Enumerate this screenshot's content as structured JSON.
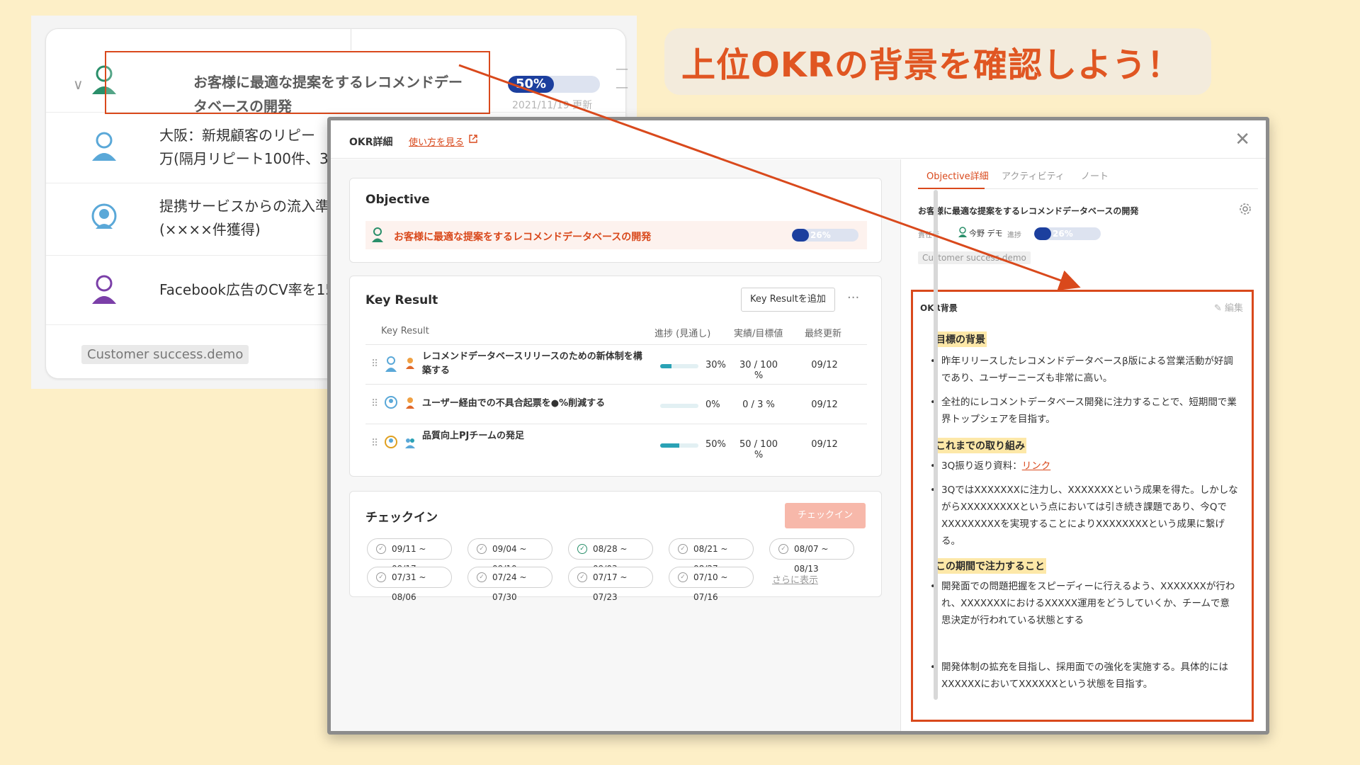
{
  "callout": {
    "text": "上位OKRの背景を確認しよう！"
  },
  "background_list": {
    "rows": [
      {
        "text": "お客様に最適な提案をするレコメンドデー\nタベースの開発",
        "progress_label": "50%",
        "progress": 0.5,
        "updated": "2021/11/19 更新"
      },
      {
        "text": "大阪：新規顧客のリピー\n万(隔月リピート100件、3"
      },
      {
        "text": "提携サービスからの流入準\n(××××件獲得)"
      },
      {
        "text": "Facebook広告のCV率を15"
      }
    ],
    "tag": "Customer success.demo"
  },
  "modal": {
    "title": "OKR詳細",
    "howto_link": "使い方を見る",
    "objective_section": {
      "title": "Objective",
      "objective_text": "お客様に最適な提案をするレコメンドデータベースの開発",
      "progress_label": "26%",
      "progress": 0.26
    },
    "key_result_section": {
      "title": "Key Result",
      "add_button": "Key Resultを追加",
      "more": "···",
      "columns": [
        "Key Result",
        "進捗 (見通し)",
        "実績/目標値",
        "最終更新"
      ],
      "rows": [
        {
          "name": "レコメンドデータベースリリースのための新体制を構築する",
          "progress": 0.3,
          "pct": "30%",
          "actual": "30 / 100 %",
          "updated": "09/12"
        },
        {
          "name": "ユーザー経由での不具合起票を●%削減する",
          "progress": 0.0,
          "pct": "0%",
          "actual": "0 / 3 %",
          "updated": "09/12"
        },
        {
          "name": "品質向上PJチームの発足",
          "progress": 0.5,
          "pct": "50%",
          "actual": "50 / 100 %",
          "updated": "09/12"
        }
      ]
    },
    "checkin_section": {
      "title": "チェックイン",
      "button": "チェックイン",
      "periods": [
        "09/11 ~ 09/17",
        "09/04 ~ 09/10",
        "08/28 ~ 09/03",
        "08/21 ~ 08/27",
        "08/07 ~ 08/13",
        "07/31 ~ 08/06",
        "07/24 ~ 07/30",
        "07/17 ~ 07/23",
        "07/10 ~ 07/16"
      ],
      "more_link": "さらに表示"
    },
    "right": {
      "tabs": [
        "Objective詳細",
        "アクティビティ",
        "ノート"
      ],
      "objective_text": "お客様に最適な提案をするレコメンドデータベースの開発",
      "owner_label": "責任者",
      "owner": "今野 デモ",
      "progress_label_text": "進捗",
      "progress_label": "26%",
      "progress": 0.26,
      "tag": "Customer success.demo",
      "background": {
        "title": "OKR背景",
        "edit": "編集",
        "h1": "目標の背景",
        "b1": "昨年リリースしたレコメンドデータベースβ版による営業活動が好調であり、ユーザーニーズも非常に高い。",
        "b2": "全社的にレコメントデータベース開発に注力することで、短期間で業界トップシェアを目指す。",
        "h2": "これまでの取り組み",
        "b3_prefix": "3Q振り返り資料：",
        "b3_link": "リンク",
        "b4": "3QではXXXXXXXに注力し、XXXXXXXという成果を得た。しかしながらXXXXXXXXXという点においては引き続き課題であり、今QでXXXXXXXXXを実現することによりXXXXXXXXという成果に繋げる。",
        "h3": "この期間で注力すること",
        "b5": "開発面での問題把握をスピーディーに行えるよう、XXXXXXXが行われ、XXXXXXXにおけるXXXXX運用をどうしていくか、チームで意思決定が行われている状態とする",
        "b6": "開発体制の拡充を目指し、採用面での強化を実施する。具体的にはXXXXXXにおいてXXXXXXという状態を目指す。"
      }
    }
  },
  "colors": {
    "accent": "#d9491c",
    "progress": "#1c3f9e",
    "kr_progress": "#2aa2b5",
    "background": "#fdefc7"
  }
}
